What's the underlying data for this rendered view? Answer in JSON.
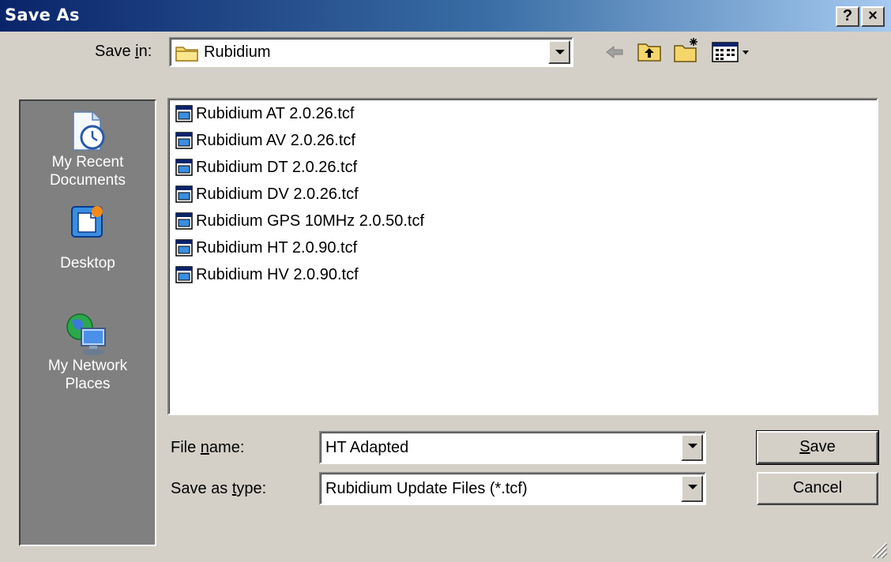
{
  "window": {
    "title": "Save As",
    "help_label": "?",
    "close_label": "×"
  },
  "save_in": {
    "label_pre": "Save ",
    "label_u": "i",
    "label_post": "n:",
    "value": "Rubidium"
  },
  "toolbar": {
    "icons": [
      "back-icon",
      "up-folder-icon",
      "new-folder-icon",
      "view-menu-icon"
    ]
  },
  "places": [
    {
      "label_line1": "My Recent",
      "label_line2": "Documents",
      "icon": "recent-documents-icon"
    },
    {
      "label_line1": "Desktop",
      "label_line2": "",
      "icon": "desktop-icon"
    },
    {
      "label_line1": "My Network",
      "label_line2": "Places",
      "icon": "network-places-icon"
    }
  ],
  "files": [
    "Rubidium AT 2.0.26.tcf",
    "Rubidium AV 2.0.26.tcf",
    "Rubidium DT 2.0.26.tcf",
    "Rubidium DV 2.0.26.tcf",
    "Rubidium GPS 10MHz 2.0.50.tcf",
    "Rubidium HT 2.0.90.tcf",
    "Rubidium HV 2.0.90.tcf"
  ],
  "file_name": {
    "label_pre": "File ",
    "label_u": "n",
    "label_post": "ame:",
    "value": "HT Adapted"
  },
  "save_type": {
    "label_pre": "Save as ",
    "label_u": "t",
    "label_post": "ype:",
    "value": "Rubidium Update Files (*.tcf)"
  },
  "buttons": {
    "save_u": "S",
    "save_rest": "ave",
    "cancel": "Cancel"
  },
  "colors": {
    "title_start": "#0a246a",
    "title_end": "#a6caf0",
    "face": "#d4d0c8",
    "places_bg": "#808080"
  }
}
